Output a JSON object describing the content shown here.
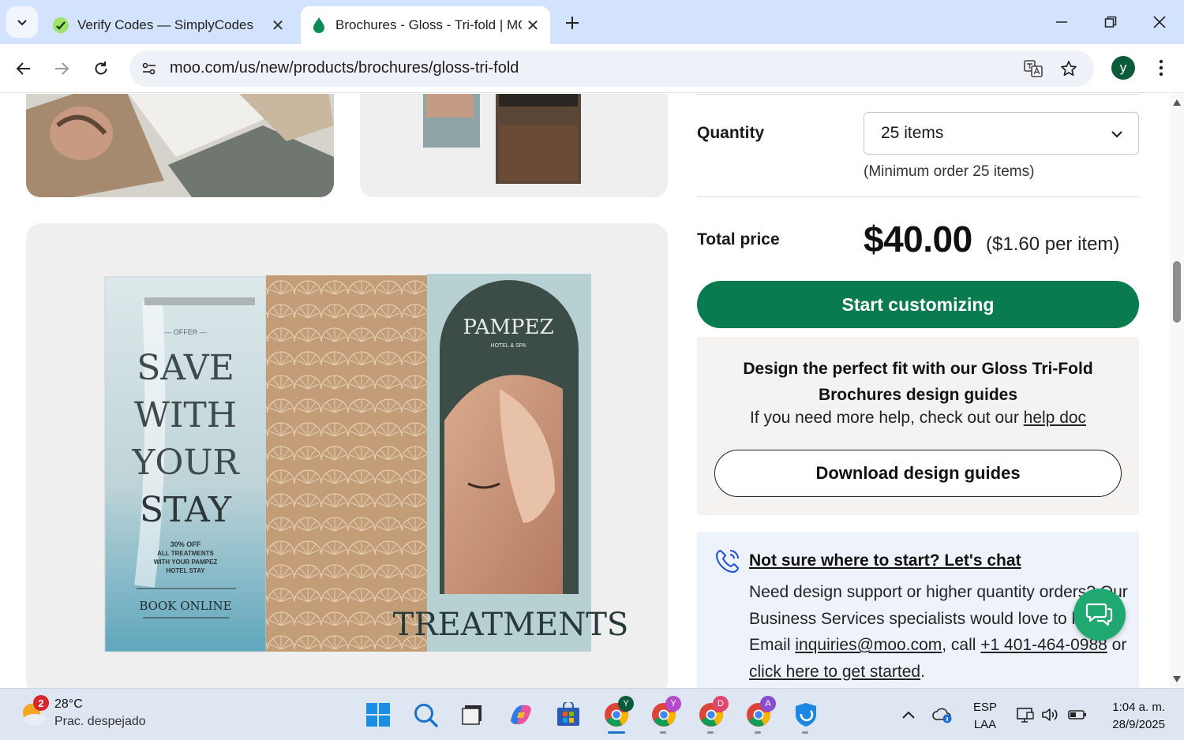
{
  "browser": {
    "tabs": [
      {
        "title": "Verify Codes — SimplyCodes",
        "active": false
      },
      {
        "title": "Brochures - Gloss - Tri-fold | MOO",
        "active": true
      }
    ],
    "url": "moo.com/us/new/products/brochures/gloss-tri-fold",
    "profile_initial": "y"
  },
  "product": {
    "quantity_label": "Quantity",
    "quantity_value": "25 items",
    "minimum_note": "(Minimum order 25 items)",
    "total_label": "Total price",
    "price": "$40.00",
    "per_item": "($1.60 per item)",
    "cta_label": "Start customizing",
    "guides": {
      "title": "Design the perfect fit with our Gloss Tri-Fold Brochures design guides",
      "help_prefix": "If you need more help, check out our ",
      "help_link": "help doc",
      "download_label": "Download design guides"
    },
    "chat": {
      "title": "Not sure where to start? Let's chat",
      "body_1": "Need design support or higher quantity orders? Our Business Services specialists would love to help. Email ",
      "email": "inquiries@moo.com",
      "body_2": ", call ",
      "phone": "+1 401-464-0988",
      "body_3": " or ",
      "start_link": "click here to get started",
      "body_4": "."
    }
  },
  "brochure_art": {
    "offer": "— OFFER —",
    "headline": [
      "SAVE",
      "WITH",
      "YOUR",
      "STAY"
    ],
    "promo": [
      "30% OFF",
      "ALL TREATMENTS",
      "WITH YOUR PAMPEZ",
      "HOTEL STAY"
    ],
    "book": "BOOK ONLINE",
    "brand": "PAMPEZ",
    "brand_sub": "HOTEL & SPA",
    "treatments": "TREATMENTS"
  },
  "taskbar": {
    "weather_badge": "2",
    "temperature": "28°C",
    "condition": "Prac. despejado",
    "lang_1": "ESP",
    "lang_2": "LAA",
    "time": "1:04 a. m.",
    "date": "28/9/2025",
    "chrome_profiles": [
      "Y",
      "Y",
      "D",
      "A"
    ]
  },
  "colors": {
    "cta_green": "#0a7a4f",
    "chat_fab": "#1fa971",
    "tabstrip": "#d3e3fd"
  }
}
